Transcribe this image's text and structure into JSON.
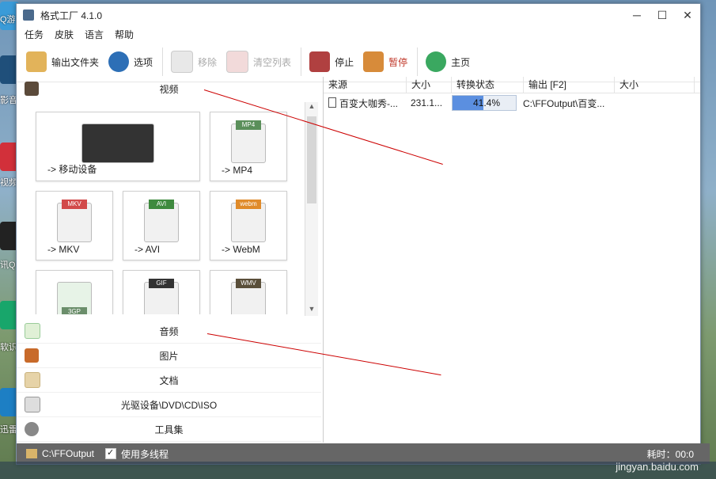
{
  "window": {
    "title": "格式工厂 4.1.0",
    "controls": [
      "─",
      "☐",
      "✕"
    ]
  },
  "menu": [
    "任务",
    "皮肤",
    "语言",
    "帮助"
  ],
  "toolbar": {
    "output_folder": "输出文件夹",
    "options": "选项",
    "remove": "移除",
    "clear_list": "清空列表",
    "stop": "停止",
    "pause": "暂停",
    "home": "主页"
  },
  "categories": {
    "video": "视频",
    "audio": "音频",
    "image": "图片",
    "document": "文档",
    "disc": "光驱设备\\DVD\\CD\\ISO",
    "tools": "工具集"
  },
  "video_tiles": [
    {
      "label": "-> 移动设备",
      "badge": ""
    },
    {
      "label": "-> MP4",
      "badge": "MP4"
    },
    {
      "label": "-> MKV",
      "badge": "MKV"
    },
    {
      "label": "-> AVI",
      "badge": "AVI"
    },
    {
      "label": "-> WebM",
      "badge": "webm"
    },
    {
      "label": "",
      "badge": "3GP"
    },
    {
      "label": "",
      "badge": "GIF"
    },
    {
      "label": "",
      "badge": "WMV"
    }
  ],
  "table": {
    "headers": [
      "来源",
      "大小",
      "转换状态",
      "输出 [F2]",
      "大小"
    ],
    "rows": [
      {
        "source": "百变大咖秀-...",
        "size": "231.1...",
        "progress": 41.4,
        "progress_text": "41.4%",
        "output": "C:\\FFOutput\\百变...",
        "out_size": ""
      }
    ]
  },
  "status": {
    "folder": "C:\\FFOutput",
    "multithread": "使用多线程",
    "elapsed": "耗时：00:0"
  },
  "watermark": "jingyan.baidu.com",
  "desktop_labels": [
    "Q游",
    "影音",
    "视频",
    "讯Q",
    "软识",
    "迅雷"
  ],
  "colors": {
    "accent": "#5b8fe0",
    "arrow": "#cc0000"
  }
}
